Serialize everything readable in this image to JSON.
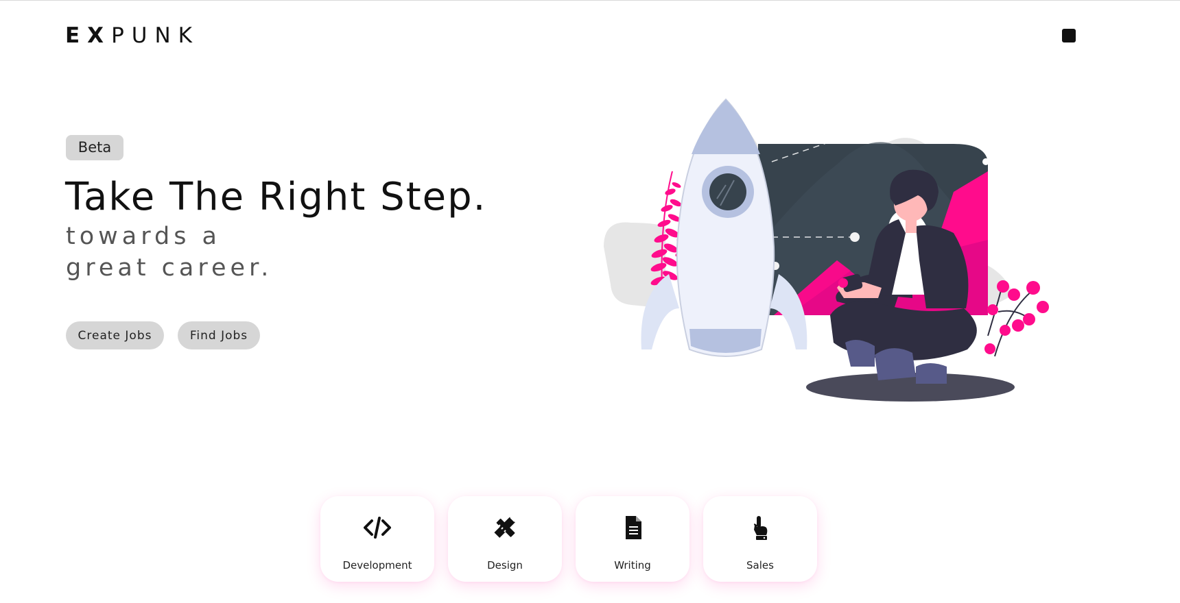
{
  "header": {
    "logo_bold": "EX",
    "logo_light": "PUNK",
    "menu_icon": "square-menu-icon"
  },
  "hero": {
    "badge": "Beta",
    "title": "Take The Right Step.",
    "subtitle": "towards a great career.",
    "buttons": {
      "create": "Create Jobs",
      "find": "Find Jobs"
    },
    "illustration": "rocket-and-person-illustration"
  },
  "categories": [
    {
      "label": "Development",
      "icon": "code-icon"
    },
    {
      "label": "Design",
      "icon": "pencil-ruler-icon"
    },
    {
      "label": "Writing",
      "icon": "document-icon"
    },
    {
      "label": "Sales",
      "icon": "pointing-hand-icon"
    }
  ],
  "colors": {
    "accent": "#ff0c8c",
    "pill_bg": "#d6d6d6",
    "dark_panel": "#37434d",
    "rocket_body": "#eef1fb",
    "rocket_accent": "#b5c1e0",
    "person_suit": "#2f2e41"
  }
}
